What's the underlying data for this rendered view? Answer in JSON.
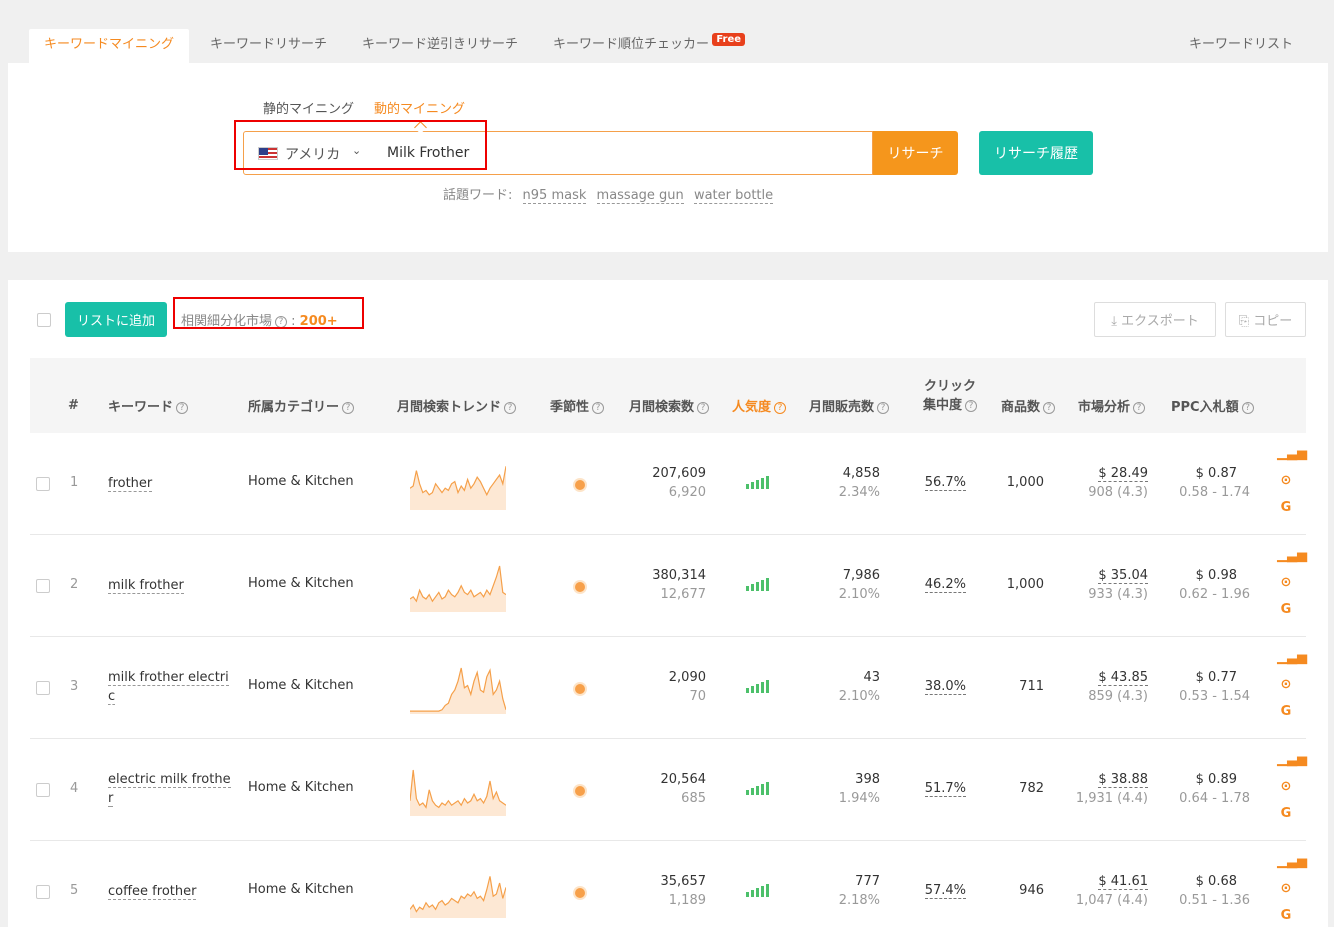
{
  "tabs": [
    {
      "label": "キーワードマイニング"
    },
    {
      "label": "キーワードリサーチ"
    },
    {
      "label": "キーワード逆引きリサーチ"
    },
    {
      "label": "キーワード順位チェッカー",
      "badge": "Free"
    },
    {
      "label": "キーワードリスト"
    }
  ],
  "search": {
    "modes": [
      "静的マイニング",
      "動的マイニング"
    ],
    "country": "アメリカ",
    "query": "Milk Frother",
    "research_button": "リサーチ",
    "history_button": "リサーチ履歴",
    "hot_label": "話題ワード:",
    "hot_words": [
      "n95 mask",
      "massage gun",
      "water bottle"
    ]
  },
  "results": {
    "add_button": "リストに追加",
    "market_label": "相関細分化市場",
    "market_value": "200+",
    "export_button": "エクスポート",
    "copy_button": "コピー",
    "columns": {
      "index": "#",
      "keyword": "キーワード",
      "category": "所属カテゴリー",
      "trend": "月間検索トレンド",
      "seasonality": "季節性",
      "searches": "月間検索数",
      "popularity": "人気度",
      "sales": "月間販売数",
      "click_1": "クリック",
      "click_2": "集中度",
      "products": "商品数",
      "market": "市場分析",
      "ppc": "PPC入札額"
    },
    "rows": [
      {
        "index": "1",
        "keyword": "frother",
        "category": "Home & Kitchen",
        "searches": "207,609",
        "searches_sub": "6,920",
        "sales": "4,858",
        "sales_sub": "2.34%",
        "click": "56.7%",
        "products": "1,000",
        "price": "$ 28.49",
        "price_sub": "908 (4.3)",
        "ppc": "$ 0.87",
        "ppc_range": "0.58 - 1.74",
        "trend": [
          0.45,
          0.5,
          0.85,
          0.55,
          0.35,
          0.4,
          0.3,
          0.35,
          0.55,
          0.45,
          0.35,
          0.45,
          0.4,
          0.55,
          0.6,
          0.35,
          0.5,
          0.4,
          0.65,
          0.45,
          0.55,
          0.7,
          0.6,
          0.45,
          0.3,
          0.45,
          0.55,
          0.65,
          0.75,
          0.55,
          0.95
        ]
      },
      {
        "index": "2",
        "keyword": "milk frother",
        "category": "Home & Kitchen",
        "searches": "380,314",
        "searches_sub": "12,677",
        "sales": "7,986",
        "sales_sub": "2.10%",
        "click": "46.2%",
        "products": "1,000",
        "price": "$ 35.04",
        "price_sub": "933 (4.3)",
        "ppc": "$ 0.98",
        "ppc_range": "0.62 - 1.96",
        "trend": [
          0.25,
          0.3,
          0.2,
          0.45,
          0.3,
          0.25,
          0.35,
          0.2,
          0.3,
          0.4,
          0.25,
          0.3,
          0.45,
          0.35,
          0.3,
          0.4,
          0.55,
          0.4,
          0.35,
          0.45,
          0.3,
          0.35,
          0.4,
          0.3,
          0.45,
          0.35,
          0.55,
          0.75,
          1.0,
          0.4,
          0.35
        ]
      },
      {
        "index": "3",
        "keyword": "milk frother electric",
        "category": "Home & Kitchen",
        "searches": "2,090",
        "searches_sub": "70",
        "sales": "43",
        "sales_sub": "2.10%",
        "click": "38.0%",
        "products": "711",
        "price": "$ 43.85",
        "price_sub": "859 (4.3)",
        "ppc": "$ 0.77",
        "ppc_range": "0.53 - 1.54",
        "trend": [
          0.02,
          0.02,
          0.02,
          0.02,
          0.02,
          0.02,
          0.02,
          0.02,
          0.02,
          0.02,
          0.05,
          0.15,
          0.2,
          0.4,
          0.5,
          0.7,
          1.0,
          0.55,
          0.6,
          0.4,
          0.7,
          0.9,
          0.5,
          0.45,
          0.8,
          0.95,
          0.4,
          0.5,
          0.7,
          0.3,
          0.05
        ]
      },
      {
        "index": "4",
        "keyword": "electric milk frother",
        "category": "Home & Kitchen",
        "searches": "20,564",
        "searches_sub": "685",
        "sales": "398",
        "sales_sub": "1.94%",
        "click": "51.7%",
        "products": "782",
        "price": "$ 38.88",
        "price_sub": "1,931 (4.4)",
        "ppc": "$ 0.89",
        "ppc_range": "0.64 - 1.78",
        "trend": [
          0.3,
          1.0,
          0.35,
          0.2,
          0.25,
          0.15,
          0.55,
          0.3,
          0.2,
          0.15,
          0.25,
          0.2,
          0.3,
          0.2,
          0.25,
          0.3,
          0.2,
          0.35,
          0.25,
          0.3,
          0.45,
          0.3,
          0.35,
          0.25,
          0.4,
          0.75,
          0.35,
          0.5,
          0.3,
          0.25,
          0.2
        ]
      },
      {
        "index": "5",
        "keyword": "coffee frother",
        "category": "Home & Kitchen",
        "searches": "35,657",
        "searches_sub": "1,189",
        "sales": "777",
        "sales_sub": "2.18%",
        "click": "57.4%",
        "products": "946",
        "price": "$ 41.61",
        "price_sub": "1,047 (4.4)",
        "ppc": "$ 0.68",
        "ppc_range": "0.51 - 1.36",
        "trend": [
          0.15,
          0.25,
          0.1,
          0.2,
          0.15,
          0.3,
          0.2,
          0.25,
          0.15,
          0.3,
          0.35,
          0.25,
          0.3,
          0.4,
          0.35,
          0.3,
          0.45,
          0.4,
          0.5,
          0.45,
          0.55,
          0.4,
          0.45,
          0.35,
          0.6,
          0.9,
          0.45,
          0.5,
          0.75,
          0.4,
          0.65
        ]
      }
    ]
  },
  "colors": {
    "accent": "#f58a20",
    "teal": "#18c0a8",
    "badge": "#e8401c",
    "bars": "#4cc06a"
  },
  "icons": [
    "chevron-down-icon",
    "download-icon",
    "copy-icon",
    "chart-icon",
    "more-icon",
    "google-icon",
    "help-icon",
    "us-flag-icon"
  ]
}
